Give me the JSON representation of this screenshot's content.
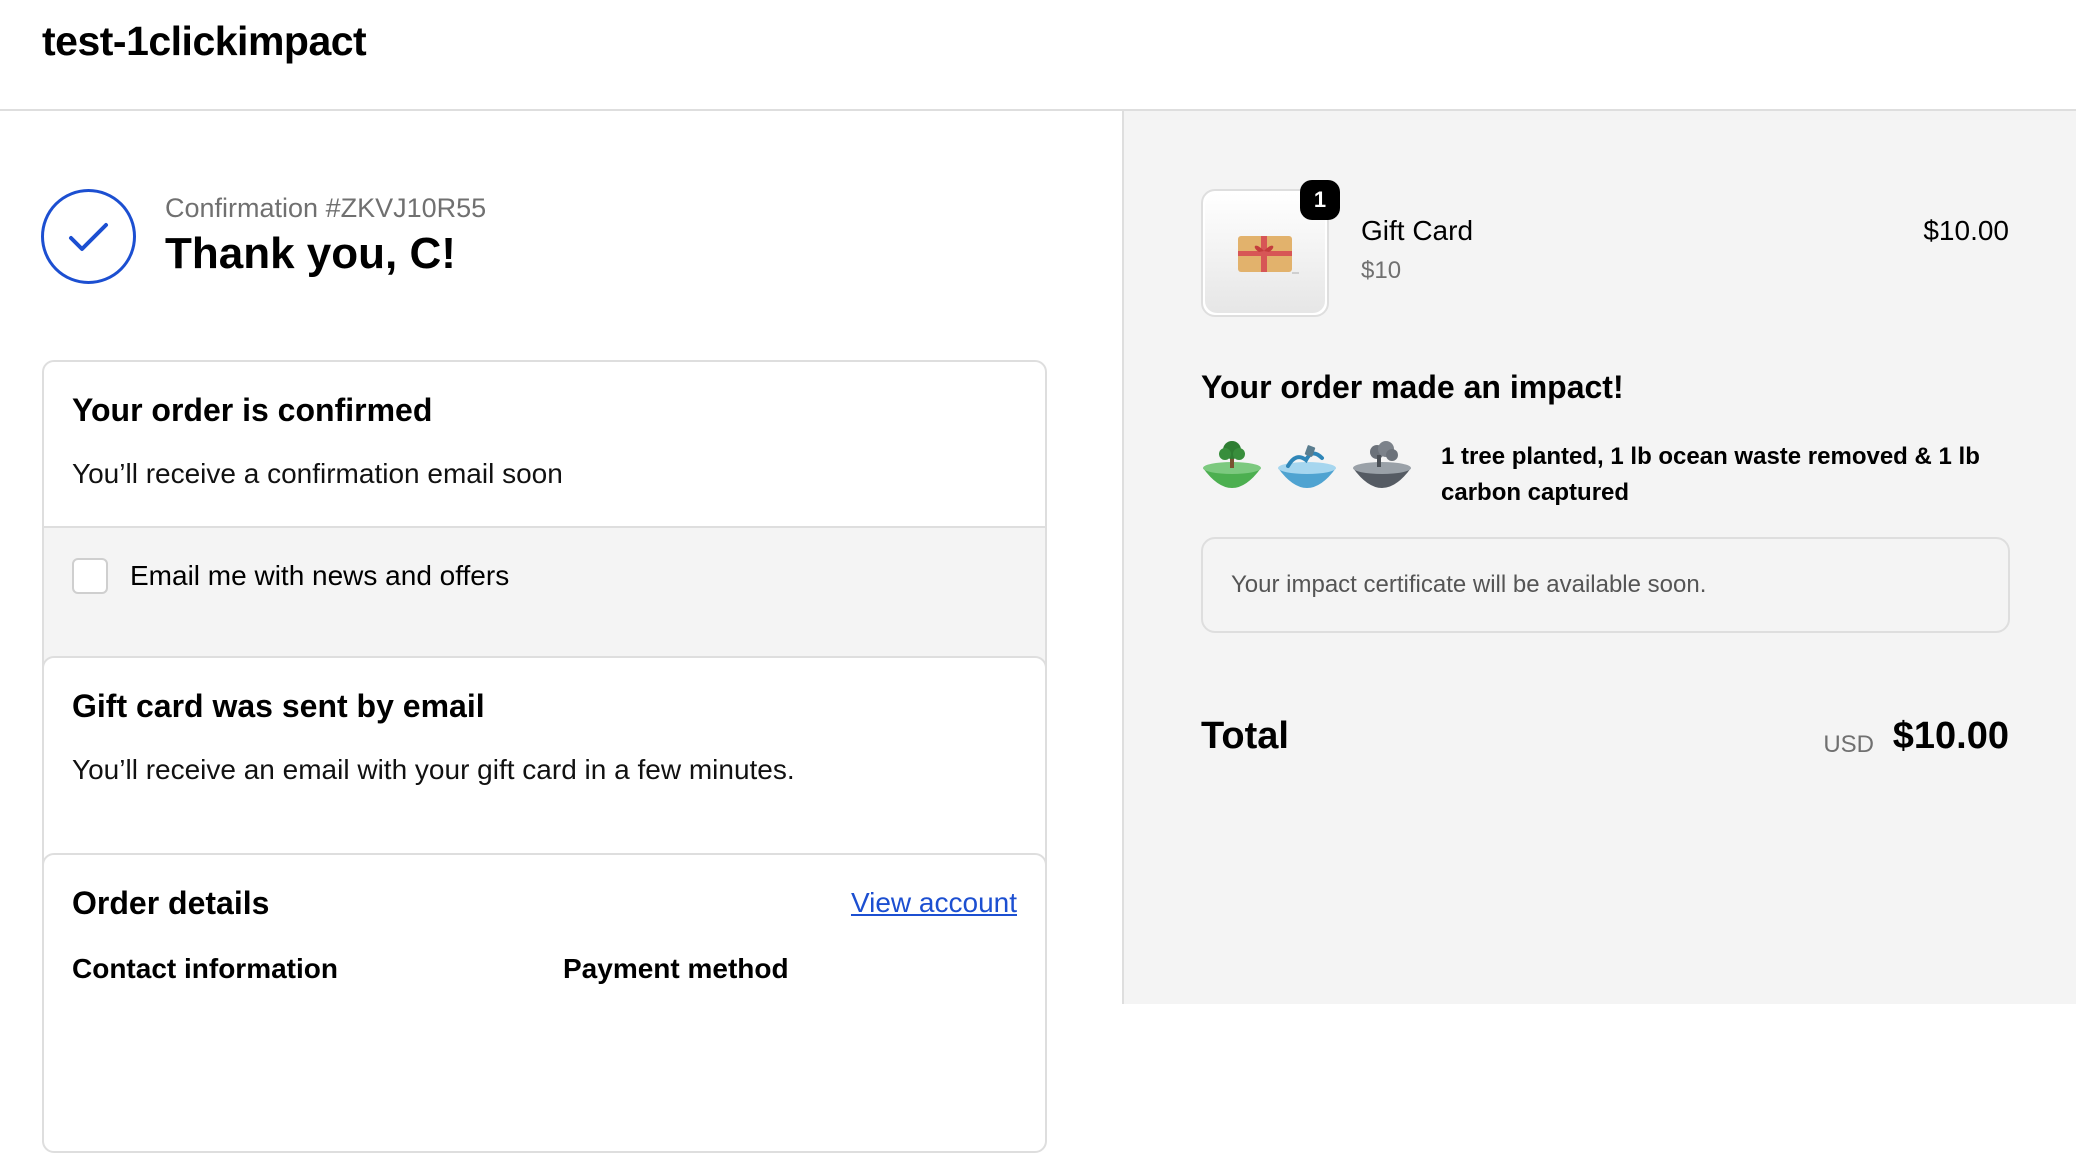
{
  "header": {
    "shop_name": "test-1clickimpact"
  },
  "confirmation": {
    "number_label": "Confirmation #ZKVJ10R55",
    "thank_you": "Thank you, C!"
  },
  "order_confirmed": {
    "title": "Your order is confirmed",
    "text": "You’ll receive a confirmation email soon",
    "newsletter_label": "Email me with news and offers",
    "newsletter_checked": false
  },
  "gift_card_notice": {
    "title": "Gift card was sent by email",
    "text": "You’ll receive an email with your gift card in a few minutes."
  },
  "order_details": {
    "title": "Order details",
    "view_account": "View account",
    "contact_heading": "Contact information",
    "payment_heading": "Payment method"
  },
  "line_item": {
    "quantity": "1",
    "name": "Gift Card",
    "variant": "$10",
    "price": "$10.00",
    "image_icon": "gift-card-icon"
  },
  "impact": {
    "title": "Your order made an impact!",
    "icons": [
      "tree-planted-icon",
      "ocean-waste-icon",
      "carbon-captured-icon"
    ],
    "summary": "1 tree planted, 1 lb ocean waste removed & 1 lb carbon captured",
    "certificate_text": "Your impact certificate will be available soon."
  },
  "totals": {
    "label": "Total",
    "currency": "USD",
    "amount": "$10.00"
  },
  "colors": {
    "accent": "#1c4fd1",
    "border": "#dedede",
    "sidebar_bg": "#f4f4f4",
    "muted_text": "#707070"
  }
}
